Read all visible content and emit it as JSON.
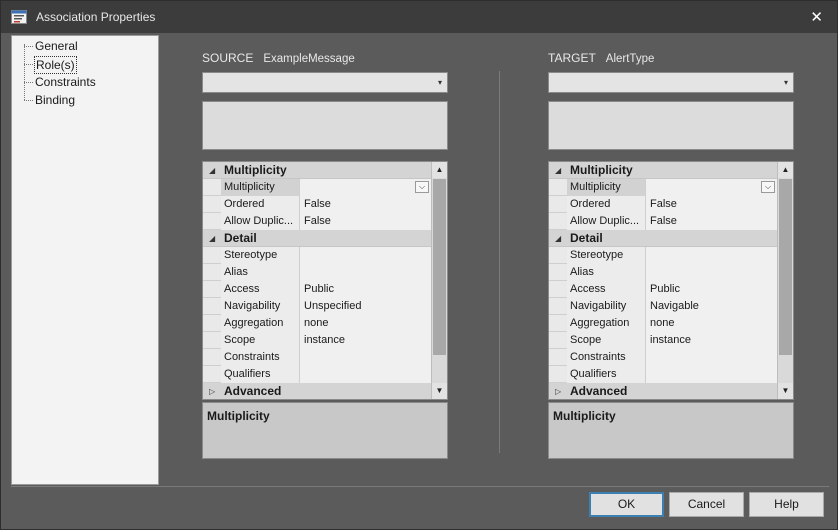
{
  "window": {
    "title": "Association Properties",
    "close_glyph": "✕"
  },
  "tree": {
    "items": [
      {
        "label": "General",
        "selected": false
      },
      {
        "label": "Role(s)",
        "selected": true
      },
      {
        "label": "Constraints",
        "selected": false
      },
      {
        "label": "Binding",
        "selected": false
      }
    ]
  },
  "source": {
    "label": "SOURCE",
    "name": "ExampleMessage",
    "combo_value": "",
    "notes": "",
    "grid": {
      "cat_multiplicity": "Multiplicity",
      "multiplicity_label": "Multiplicity",
      "multiplicity_value": "",
      "ordered_label": "Ordered",
      "ordered_value": "False",
      "allowdup_label": "Allow Duplic...",
      "allowdup_value": "False",
      "cat_detail": "Detail",
      "stereotype_label": "Stereotype",
      "stereotype_value": "",
      "alias_label": "Alias",
      "alias_value": "",
      "access_label": "Access",
      "access_value": "Public",
      "navigability_label": "Navigability",
      "navigability_value": "Unspecified",
      "aggregation_label": "Aggregation",
      "aggregation_value": "none",
      "scope_label": "Scope",
      "scope_value": "instance",
      "constraints_label": "Constraints",
      "constraints_value": "",
      "qualifiers_label": "Qualifiers",
      "qualifiers_value": "",
      "cat_advanced": "Advanced"
    },
    "description_title": "Multiplicity"
  },
  "target": {
    "label": "TARGET",
    "name": "AlertType",
    "combo_value": "",
    "notes": "",
    "grid": {
      "cat_multiplicity": "Multiplicity",
      "multiplicity_label": "Multiplicity",
      "multiplicity_value": "",
      "ordered_label": "Ordered",
      "ordered_value": "False",
      "allowdup_label": "Allow Duplic...",
      "allowdup_value": "False",
      "cat_detail": "Detail",
      "stereotype_label": "Stereotype",
      "stereotype_value": "",
      "alias_label": "Alias",
      "alias_value": "",
      "access_label": "Access",
      "access_value": "Public",
      "navigability_label": "Navigability",
      "navigability_value": "Navigable",
      "aggregation_label": "Aggregation",
      "aggregation_value": "none",
      "scope_label": "Scope",
      "scope_value": "instance",
      "constraints_label": "Constraints",
      "constraints_value": "",
      "qualifiers_label": "Qualifiers",
      "qualifiers_value": "",
      "cat_advanced": "Advanced"
    },
    "description_title": "Multiplicity"
  },
  "glyphs": {
    "expanded": "◢",
    "collapsed": "▷",
    "dropdown": "▾",
    "chevron": "⌵",
    "scroll_up": "▲",
    "scroll_down": "▼"
  },
  "buttons": {
    "ok": "OK",
    "cancel": "Cancel",
    "help": "Help"
  },
  "colors": {
    "titlebar": "#3c3c3c",
    "dialog_bg": "#5b5b5b",
    "default_button_border": "#3c7fb1"
  }
}
